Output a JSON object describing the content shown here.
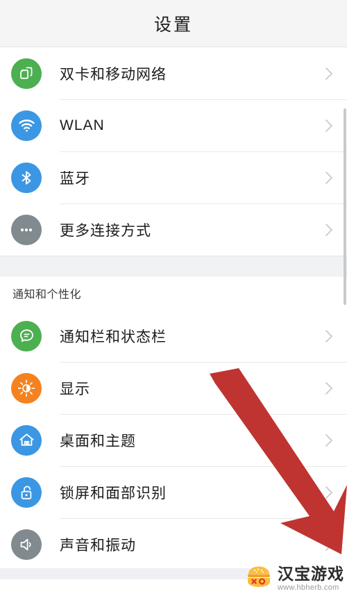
{
  "header": {
    "title": "设置"
  },
  "scrollbar": {
    "visible": true
  },
  "groups": [
    {
      "section_label": "",
      "rows": [
        {
          "label": "双卡和移动网络",
          "icon": "dual-sim-icon",
          "icon_color": "#4caf50",
          "chevron": "chevron-right-icon"
        },
        {
          "label": "WLAN",
          "icon": "wifi-icon",
          "icon_color": "#3b97e3",
          "chevron": "chevron-right-icon"
        },
        {
          "label": "蓝牙",
          "icon": "bluetooth-icon",
          "icon_color": "#3b97e3",
          "chevron": "chevron-right-icon"
        },
        {
          "label": "更多连接方式",
          "icon": "more-dots-icon",
          "icon_color": "#808a8f",
          "chevron": "chevron-right-icon"
        }
      ]
    },
    {
      "section_label": "通知和个性化",
      "rows": [
        {
          "label": "通知栏和状态栏",
          "icon": "chat-bubble-icon",
          "icon_color": "#4caf50",
          "chevron": "chevron-right-icon"
        },
        {
          "label": "显示",
          "icon": "brightness-icon",
          "icon_color": "#f5821f",
          "chevron": "chevron-right-icon"
        },
        {
          "label": "桌面和主题",
          "icon": "home-icon",
          "icon_color": "#3b97e3",
          "chevron": "chevron-right-icon"
        },
        {
          "label": "锁屏和面部识别",
          "icon": "unlock-icon",
          "icon_color": "#3b97e3",
          "chevron": "chevron-right-icon"
        },
        {
          "label": "声音和振动",
          "icon": "speaker-icon",
          "icon_color": "#808a8f",
          "chevron": "chevron-right-icon"
        }
      ]
    }
  ],
  "annotation": {
    "name": "red-down-right-arrow",
    "color": "#bf3430"
  },
  "watermark": {
    "name": "汉宝游戏",
    "url": "www.hbherb.com",
    "logo_name": "burger-logo-icon"
  }
}
